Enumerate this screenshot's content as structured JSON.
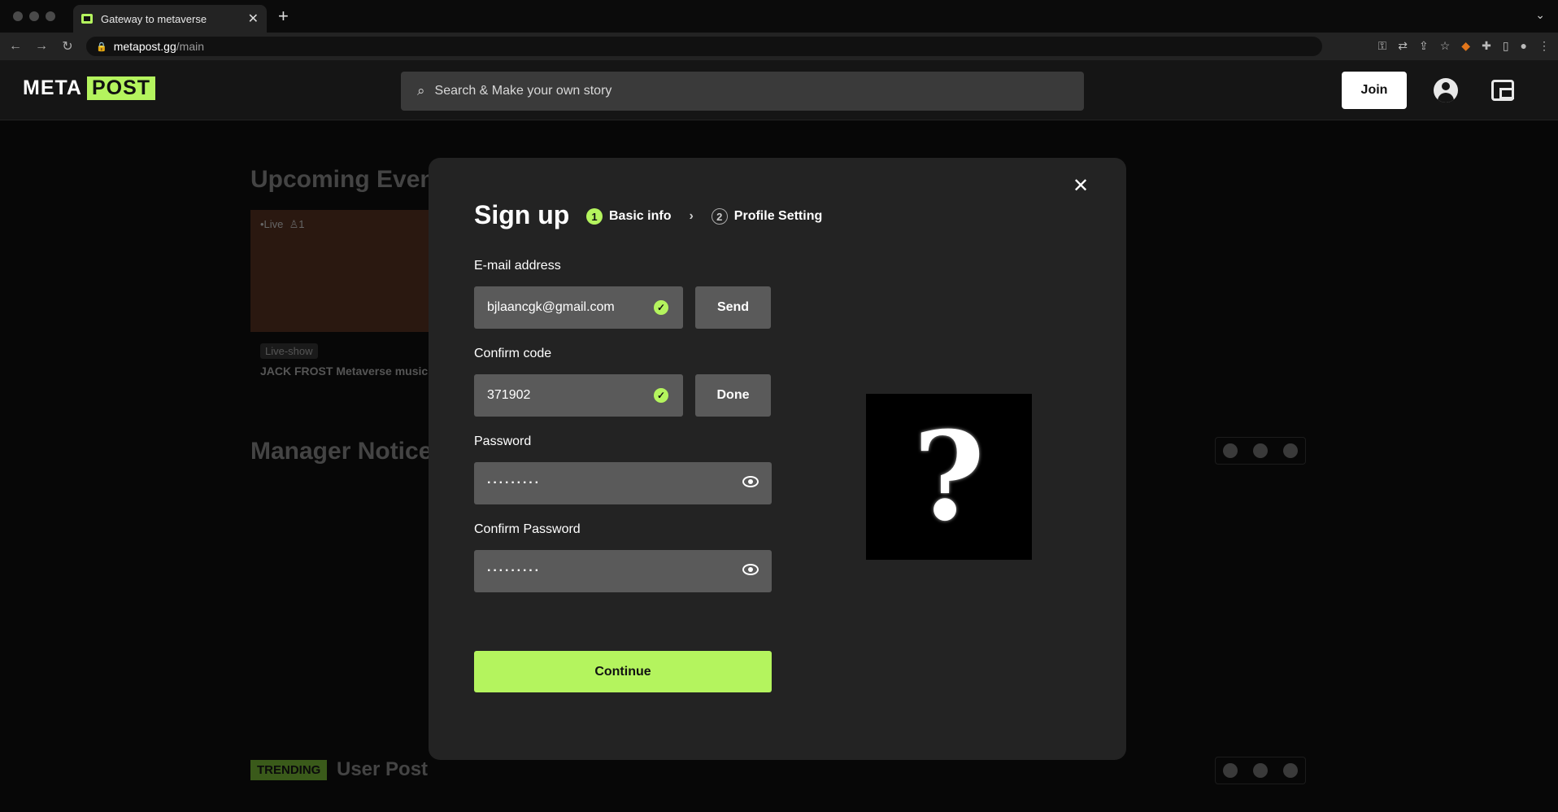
{
  "browser": {
    "tab_title": "Gateway to metaverse",
    "url_host": "metapost.gg",
    "url_path": "/main"
  },
  "site": {
    "logo_meta": "META",
    "logo_post": "POST",
    "search_placeholder": "Search & Make your own story",
    "join_label": "Join"
  },
  "background": {
    "upcoming_title": "Upcoming Even",
    "live_label": "•Live",
    "live_count": "1",
    "live_tag": "Live-show",
    "event_title": "JACK FROST Metaverse music c",
    "manager_title": "Manager Notice",
    "trending_badge": "TRENDING",
    "user_post_title": "User Post"
  },
  "modal": {
    "title": "Sign up",
    "steps": [
      {
        "num": "1",
        "label": "Basic info"
      },
      {
        "num": "2",
        "label": "Profile Setting"
      }
    ],
    "email_label": "E-mail address",
    "email_value": "bjlaancgk@gmail.com",
    "send_label": "Send",
    "code_label": "Confirm code",
    "code_value": "371902",
    "done_label": "Done",
    "password_label": "Password",
    "password_value": "·········",
    "confirm_label": "Confirm Password",
    "confirm_value": "·········",
    "continue_label": "Continue",
    "avatar_glyph": "?"
  },
  "colors": {
    "accent": "#b4f45e",
    "modal_bg": "#232323",
    "field_bg": "#5a5a5a"
  }
}
